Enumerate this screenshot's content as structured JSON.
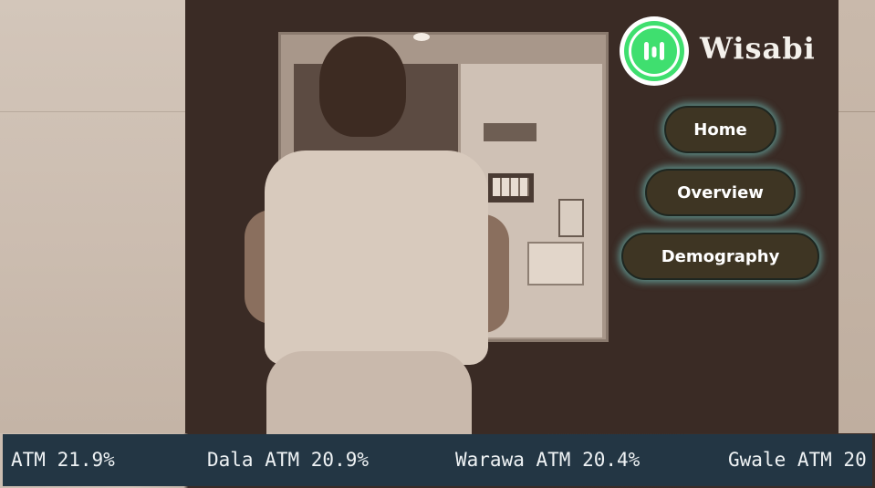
{
  "brand": {
    "name": "Wisabi",
    "logo_color": "#3fdf6f"
  },
  "nav": {
    "items": [
      {
        "label": "Home"
      },
      {
        "label": "Overview"
      },
      {
        "label": "Demography"
      }
    ],
    "button_color": "#3e3523",
    "glow_color": "#78dcd7"
  },
  "ticker": {
    "items": [
      {
        "text": "ATM 21.9%"
      },
      {
        "text": "Dala ATM 20.9%"
      },
      {
        "text": "Warawa ATM 20.4%"
      },
      {
        "text": "Gwale ATM 20"
      }
    ],
    "background": "#233644"
  },
  "background_photo": {
    "icon": "atm-photo"
  }
}
